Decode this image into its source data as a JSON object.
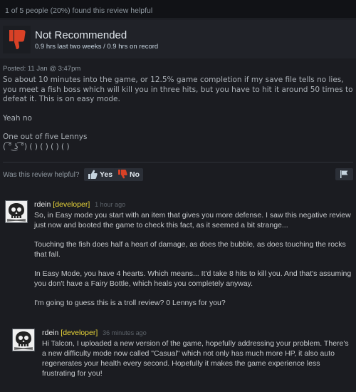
{
  "helpful_summary": "1 of 5 people (20%) found this review helpful",
  "verdict": {
    "title": "Not Recommended",
    "hours": "0.9 hrs last two weeks / 0.9 hrs on record",
    "icon": "thumbs-down-icon",
    "color": "#d94126"
  },
  "posted": "Posted: 11 Jan @ 3:47pm",
  "review": {
    "paragraphs": [
      "So about 10 minutes into the game, or 12.5% game completion if my save file tells no lies, you meet a fish boss which will kill you in three hits, but you have to hit it around 50 times to defeat it. This is on easy mode.",
      "Yeah no",
      "One out of five Lennys\n( ͡° ͜ʖ ͡°) ( ) ( ) ( ) ( )"
    ]
  },
  "vote": {
    "question": "Was this review helpful?",
    "yes": "Yes",
    "no": "No"
  },
  "comments": [
    {
      "author": "rdein",
      "role": "[developer]",
      "time": "1 hour ago",
      "paragraphs": [
        "So, in Easy mode you start with an item that gives you more defense. I saw this negative review just now and booted the game to check this fact, as it seemed a bit strange...",
        "Touching the fish does half a heart of damage, as does the bubble, as does touching the rocks that fall.",
        "In Easy Mode, you have 4 hearts. Which means... It'd take 8 hits to kill you. And that's assuming you don't have a Fairy Bottle, which heals you completely anyway.",
        "I'm going to guess this is a troll review? 0 Lennys for you?"
      ]
    },
    {
      "author": "rdein",
      "role": "[developer]",
      "time": "36 minutes ago",
      "paragraphs": [
        "Hi Talcon, I uploaded a new version of the game, hopefully addressing your problem. There's a new difficulty mode now called \"Casual\" which not only has much more HP, it also auto regenerates your health every second. Hopefully it makes the game experience less frustrating for you!"
      ]
    }
  ]
}
